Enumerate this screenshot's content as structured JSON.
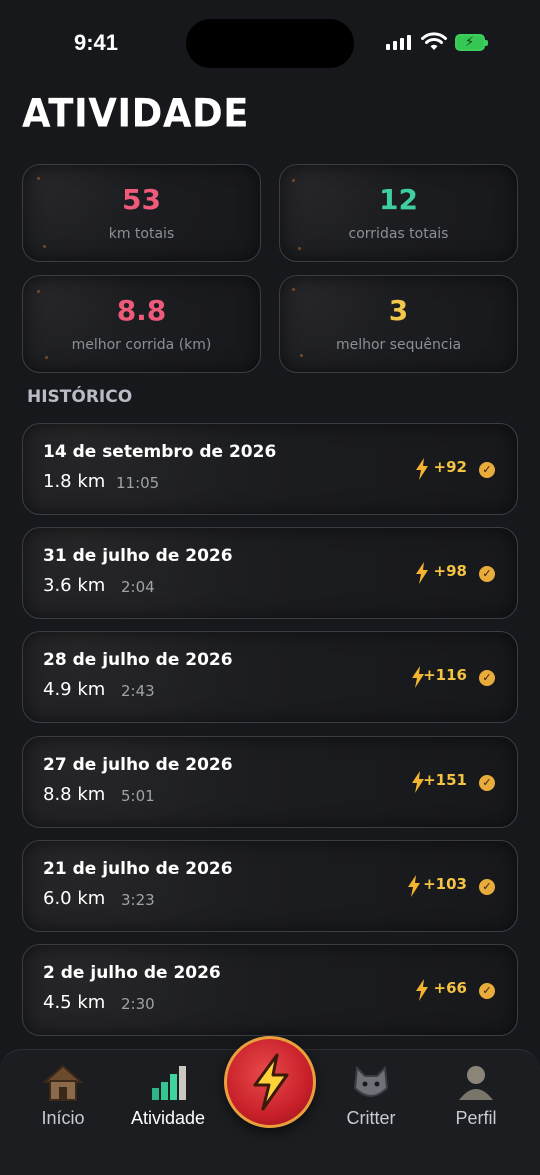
{
  "status_bar": {
    "time": "9:41"
  },
  "page_title": "ATIVIDADE",
  "stats": [
    {
      "value": "53",
      "label": "km totais",
      "color": "#ef5a7a"
    },
    {
      "value": "12",
      "label": "corridas totais",
      "color": "#3fcf9e"
    },
    {
      "value": "8.8",
      "label": "melhor corrida (km)",
      "color": "#ef5a7a"
    },
    {
      "value": "3",
      "label": "melhor sequência",
      "color": "#f2c64a"
    }
  ],
  "history": {
    "title": "HISTÓRICO",
    "runs": [
      {
        "date": "14 de setembro de 2026",
        "distance": "1.8 km",
        "duration": "11:05",
        "points": "+92"
      },
      {
        "date": "31 de julho de 2026",
        "distance": "3.6 km",
        "duration": "2:04",
        "points": "+98"
      },
      {
        "date": "28 de julho de 2026",
        "distance": "4.9 km",
        "duration": "2:43",
        "points": "+116"
      },
      {
        "date": "27 de julho de 2026",
        "distance": "8.8 km",
        "duration": "5:01",
        "points": "+151"
      },
      {
        "date": "21 de julho de 2026",
        "distance": "6.0 km",
        "duration": "3:23",
        "points": "+103"
      },
      {
        "date": "2 de julho de 2026",
        "distance": "4.5 km",
        "duration": "2:30",
        "points": "+66"
      }
    ]
  },
  "nav": {
    "items": [
      {
        "label": "Início",
        "icon": "house-icon"
      },
      {
        "label": "Atividade",
        "icon": "bar-chart-icon"
      },
      {
        "label": "Critter",
        "icon": "cat-icon"
      },
      {
        "label": "Perfil",
        "icon": "profile-icon"
      }
    ],
    "center_icon": "lightning-icon",
    "active": "Atividade"
  }
}
